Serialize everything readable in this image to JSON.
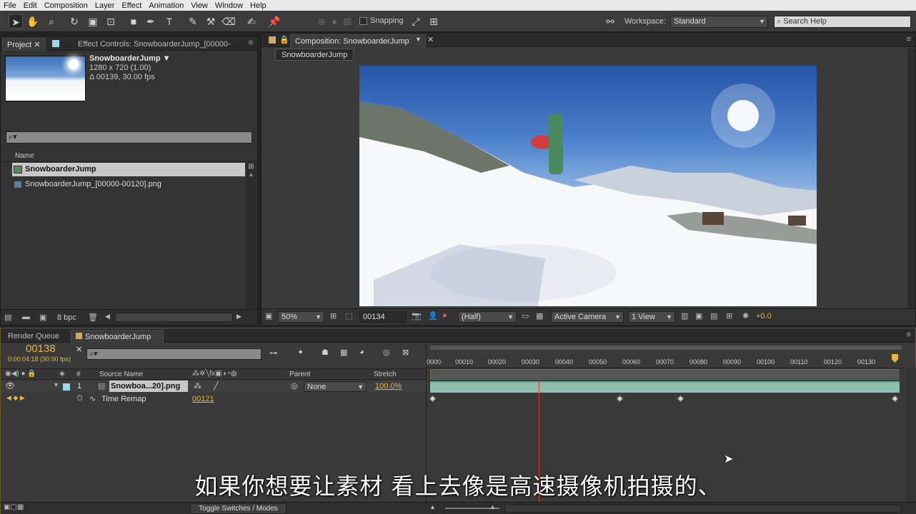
{
  "menu": [
    "File",
    "Edit",
    "Composition",
    "Layer",
    "Effect",
    "Animation",
    "View",
    "Window",
    "Help"
  ],
  "toolbar": {
    "snapping_label": "Snapping",
    "workspace_label": "Workspace:",
    "workspace_value": "Standard",
    "search_placeholder": "Search Help"
  },
  "project_panel": {
    "tab_project": "Project",
    "tab_effect_controls": "Effect Controls: SnowboarderJump_[00000-",
    "item_name": "SnowboarderJump ▼",
    "item_res": "1280 x 720 (1.00)",
    "item_duration": "Δ 00139, 30.00 fps",
    "column_name": "Name",
    "items": [
      "SnowboarderJump",
      "SnowboarderJump_[00000-00120].png"
    ],
    "bpc": "8 bpc"
  },
  "composition_panel": {
    "tab_label": "Composition: SnowboarderJump",
    "breadcrumb": "SnowboarderJump",
    "zoom": "50%",
    "timecode": "00134",
    "resolution": "(Half)",
    "camera": "Active Camera",
    "views": "1 View",
    "exposure": "+0.0"
  },
  "timeline_panel": {
    "tab_render_queue": "Render Queue",
    "tab_comp": "SnowboarderJump",
    "current_time": "00138",
    "current_time_sub": "0:00:04:18 (30.00 fps)",
    "col_source_name": "Source Name",
    "col_parent": "Parent",
    "col_stretch": "Stretch",
    "layer_index": "1",
    "layer_name": "Snowboa...20].png",
    "parent_value": "None",
    "stretch_value": "100.0%",
    "property_name": "Time Remap",
    "property_value": "00121",
    "toggle_label": "Toggle Switches / Modes",
    "ruler_ticks": [
      "0000",
      "00010",
      "00020",
      "00030",
      "00040",
      "00050",
      "00060",
      "00070",
      "00080",
      "00090",
      "00100",
      "00110",
      "00120",
      "00130"
    ]
  },
  "subtitle": "如果你想要让素材 看上去像是高速摄像机拍摄的、"
}
